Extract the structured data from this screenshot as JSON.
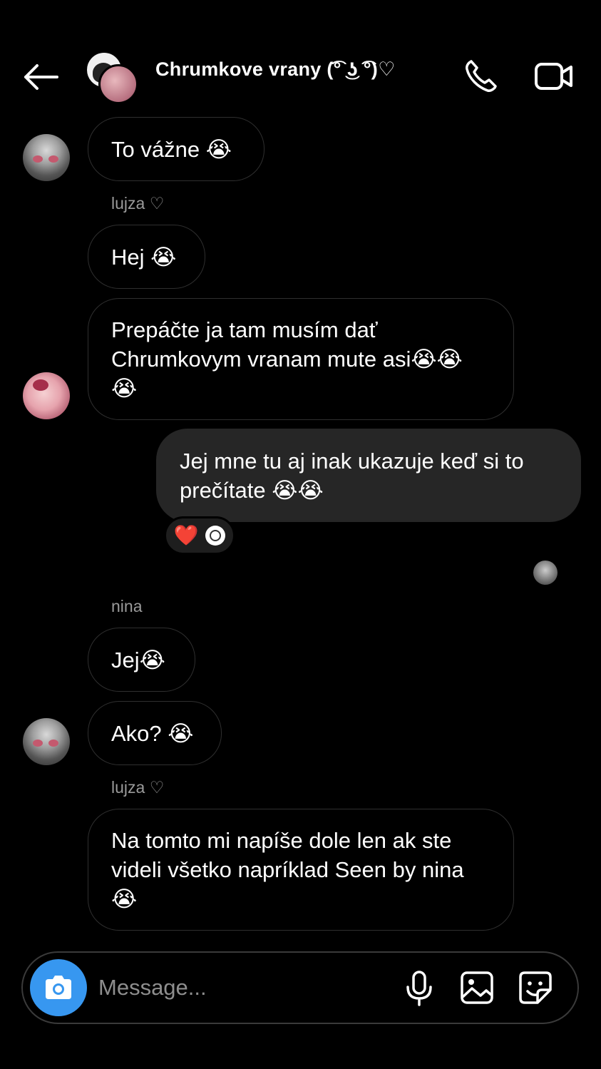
{
  "header": {
    "title": "Chrumkove vrany (͡° ͜ʖ ͡°)♡",
    "back_icon": "arrow-left-icon",
    "call_icon": "phone-icon",
    "video_icon": "video-camera-icon"
  },
  "messages": [
    {
      "text": "To vážne 😭",
      "direction": "incoming"
    },
    {
      "sender": "lujza ♡"
    },
    {
      "text": "Hej 😭",
      "direction": "incoming"
    },
    {
      "text": "Prepáčte ja tam musím dať\nChrumkovym vranam mute asi😭😭\n😭",
      "direction": "incoming"
    },
    {
      "text": "Jej mne tu aj inak ukazuje keď si to\nprečítate 😭😭",
      "direction": "outgoing",
      "reactions": [
        "❤️"
      ]
    },
    {
      "sender": "nina"
    },
    {
      "text": "Jej😭",
      "direction": "incoming"
    },
    {
      "text": "Ako? 😭",
      "direction": "incoming"
    },
    {
      "sender": "lujza ♡"
    },
    {
      "text": "Na tomto mi napíše dole len ak ste\nvideli všetko napríklad Seen by nina\n😭",
      "direction": "incoming"
    }
  ],
  "composer": {
    "placeholder": "Message...",
    "camera_icon": "camera-icon",
    "mic_icon": "microphone-icon",
    "gallery_icon": "image-icon",
    "sticker_icon": "sticker-icon"
  },
  "colors": {
    "background": "#000000",
    "outgoing_bubble": "#262626",
    "camera_button": "#3797f0",
    "heart": "#e0192f"
  }
}
